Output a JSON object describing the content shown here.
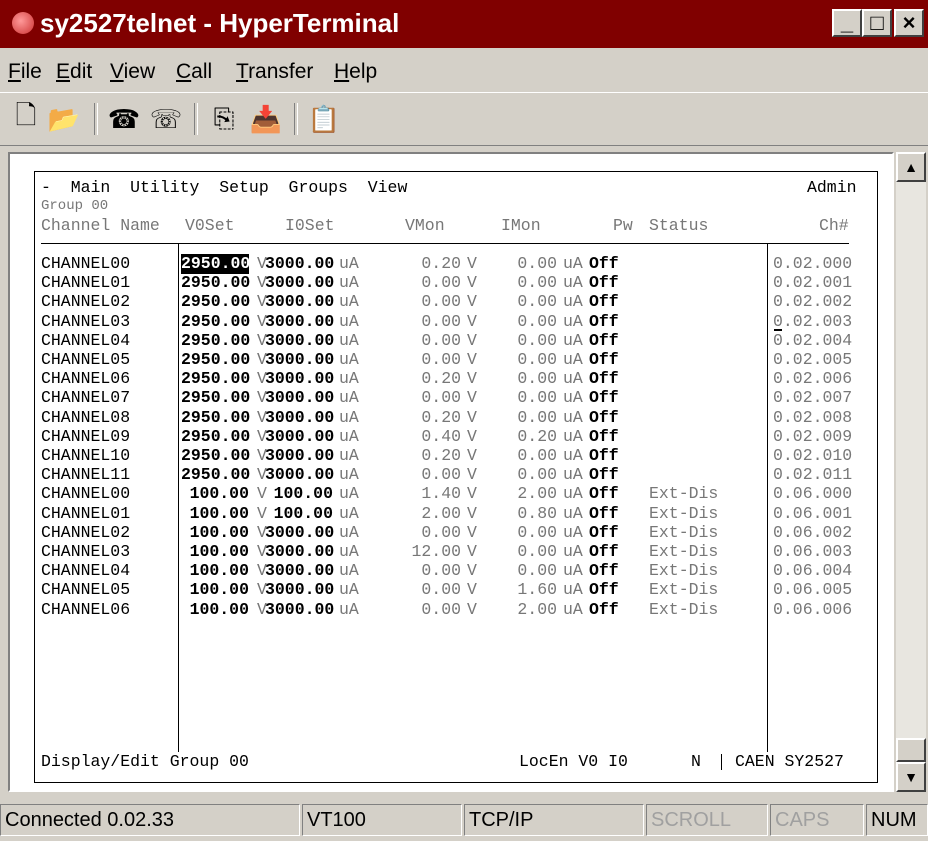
{
  "window": {
    "title": "sy2527telnet - HyperTerminal",
    "minimize": "_",
    "maximize": "□",
    "close": "×"
  },
  "menu": [
    {
      "label": "File",
      "accel": "F",
      "rest": "ile"
    },
    {
      "label": "Edit",
      "accel": "E",
      "rest": "dit"
    },
    {
      "label": "View",
      "accel": "V",
      "rest": "iew"
    },
    {
      "label": "Call",
      "accel": "C",
      "rest": "all"
    },
    {
      "label": "Transfer",
      "accel": "T",
      "rest": "ransfer"
    },
    {
      "label": "Help",
      "accel": "H",
      "rest": "elp"
    }
  ],
  "toolbar": [
    {
      "name": "new-icon",
      "glyph": "🗋"
    },
    {
      "name": "open-icon",
      "glyph": "📂"
    },
    {
      "name": "call-icon",
      "glyph": "☎"
    },
    {
      "name": "disconnect-icon",
      "glyph": "☏"
    },
    {
      "name": "send-icon",
      "glyph": "⎘"
    },
    {
      "name": "receive-icon",
      "glyph": "📥"
    },
    {
      "name": "properties-icon",
      "glyph": "📋"
    }
  ],
  "terminal": {
    "menu_line": "-  Main  Utility  Setup  Groups  View",
    "admin": "Admin",
    "group": "Group 00",
    "headers": {
      "name": "Channel Name",
      "v0set": "V0Set",
      "i0set": "I0Set",
      "vmon": "VMon",
      "imon": "IMon",
      "pw": "Pw",
      "status": "Status",
      "ch": "Ch#"
    },
    "rows": [
      {
        "name": "CHANNEL00",
        "v0set": "2950.00",
        "i0set": "3000.00",
        "vmon": "0.20",
        "imon": "0.00",
        "pw": "Off",
        "status": "",
        "ch": "0.02.000"
      },
      {
        "name": "CHANNEL01",
        "v0set": "2950.00",
        "i0set": "3000.00",
        "vmon": "0.00",
        "imon": "0.00",
        "pw": "Off",
        "status": "",
        "ch": "0.02.001"
      },
      {
        "name": "CHANNEL02",
        "v0set": "2950.00",
        "i0set": "3000.00",
        "vmon": "0.00",
        "imon": "0.00",
        "pw": "Off",
        "status": "",
        "ch": "0.02.002"
      },
      {
        "name": "CHANNEL03",
        "v0set": "2950.00",
        "i0set": "3000.00",
        "vmon": "0.00",
        "imon": "0.00",
        "pw": "Off",
        "status": "",
        "ch": "0.02.003"
      },
      {
        "name": "CHANNEL04",
        "v0set": "2950.00",
        "i0set": "3000.00",
        "vmon": "0.00",
        "imon": "0.00",
        "pw": "Off",
        "status": "",
        "ch": "0.02.004"
      },
      {
        "name": "CHANNEL05",
        "v0set": "2950.00",
        "i0set": "3000.00",
        "vmon": "0.00",
        "imon": "0.00",
        "pw": "Off",
        "status": "",
        "ch": "0.02.005"
      },
      {
        "name": "CHANNEL06",
        "v0set": "2950.00",
        "i0set": "3000.00",
        "vmon": "0.20",
        "imon": "0.00",
        "pw": "Off",
        "status": "",
        "ch": "0.02.006"
      },
      {
        "name": "CHANNEL07",
        "v0set": "2950.00",
        "i0set": "3000.00",
        "vmon": "0.00",
        "imon": "0.00",
        "pw": "Off",
        "status": "",
        "ch": "0.02.007"
      },
      {
        "name": "CHANNEL08",
        "v0set": "2950.00",
        "i0set": "3000.00",
        "vmon": "0.20",
        "imon": "0.00",
        "pw": "Off",
        "status": "",
        "ch": "0.02.008"
      },
      {
        "name": "CHANNEL09",
        "v0set": "2950.00",
        "i0set": "3000.00",
        "vmon": "0.40",
        "imon": "0.20",
        "pw": "Off",
        "status": "",
        "ch": "0.02.009"
      },
      {
        "name": "CHANNEL10",
        "v0set": "2950.00",
        "i0set": "3000.00",
        "vmon": "0.20",
        "imon": "0.00",
        "pw": "Off",
        "status": "",
        "ch": "0.02.010"
      },
      {
        "name": "CHANNEL11",
        "v0set": "2950.00",
        "i0set": "3000.00",
        "vmon": "0.00",
        "imon": "0.00",
        "pw": "Off",
        "status": "",
        "ch": "0.02.011"
      },
      {
        "name": "CHANNEL00",
        "v0set": "100.00",
        "i0set": "100.00",
        "vmon": "1.40",
        "imon": "2.00",
        "pw": "Off",
        "status": "Ext-Dis",
        "ch": "0.06.000"
      },
      {
        "name": "CHANNEL01",
        "v0set": "100.00",
        "i0set": "100.00",
        "vmon": "2.00",
        "imon": "0.80",
        "pw": "Off",
        "status": "Ext-Dis",
        "ch": "0.06.001"
      },
      {
        "name": "CHANNEL02",
        "v0set": "100.00",
        "i0set": "3000.00",
        "vmon": "0.00",
        "imon": "0.00",
        "pw": "Off",
        "status": "Ext-Dis",
        "ch": "0.06.002"
      },
      {
        "name": "CHANNEL03",
        "v0set": "100.00",
        "i0set": "3000.00",
        "vmon": "12.00",
        "imon": "0.00",
        "pw": "Off",
        "status": "Ext-Dis",
        "ch": "0.06.003"
      },
      {
        "name": "CHANNEL04",
        "v0set": "100.00",
        "i0set": "3000.00",
        "vmon": "0.00",
        "imon": "0.00",
        "pw": "Off",
        "status": "Ext-Dis",
        "ch": "0.06.004"
      },
      {
        "name": "CHANNEL05",
        "v0set": "100.00",
        "i0set": "3000.00",
        "vmon": "0.00",
        "imon": "1.60",
        "pw": "Off",
        "status": "Ext-Dis",
        "ch": "0.06.005"
      },
      {
        "name": "CHANNEL06",
        "v0set": "100.00",
        "i0set": "3000.00",
        "vmon": "0.00",
        "imon": "2.00",
        "pw": "Off",
        "status": "Ext-Dis",
        "ch": "0.06.006"
      }
    ],
    "units": {
      "v": "V",
      "ua": "uA"
    },
    "footer_left": "Display/Edit Group 00",
    "footer_flags": "LocEn V0 I0",
    "footer_mode": "N",
    "footer_model": "CAEN SY2527"
  },
  "statusbar": [
    {
      "name": "status-connected",
      "text": "Connected 0.02.33",
      "grey": false
    },
    {
      "name": "status-emulation",
      "text": "VT100",
      "grey": false
    },
    {
      "name": "status-protocol",
      "text": "TCP/IP",
      "grey": false
    },
    {
      "name": "status-scroll",
      "text": "SCROLL",
      "grey": true
    },
    {
      "name": "status-caps",
      "text": "CAPS",
      "grey": true
    },
    {
      "name": "status-num",
      "text": "NUM",
      "grey": false
    }
  ]
}
